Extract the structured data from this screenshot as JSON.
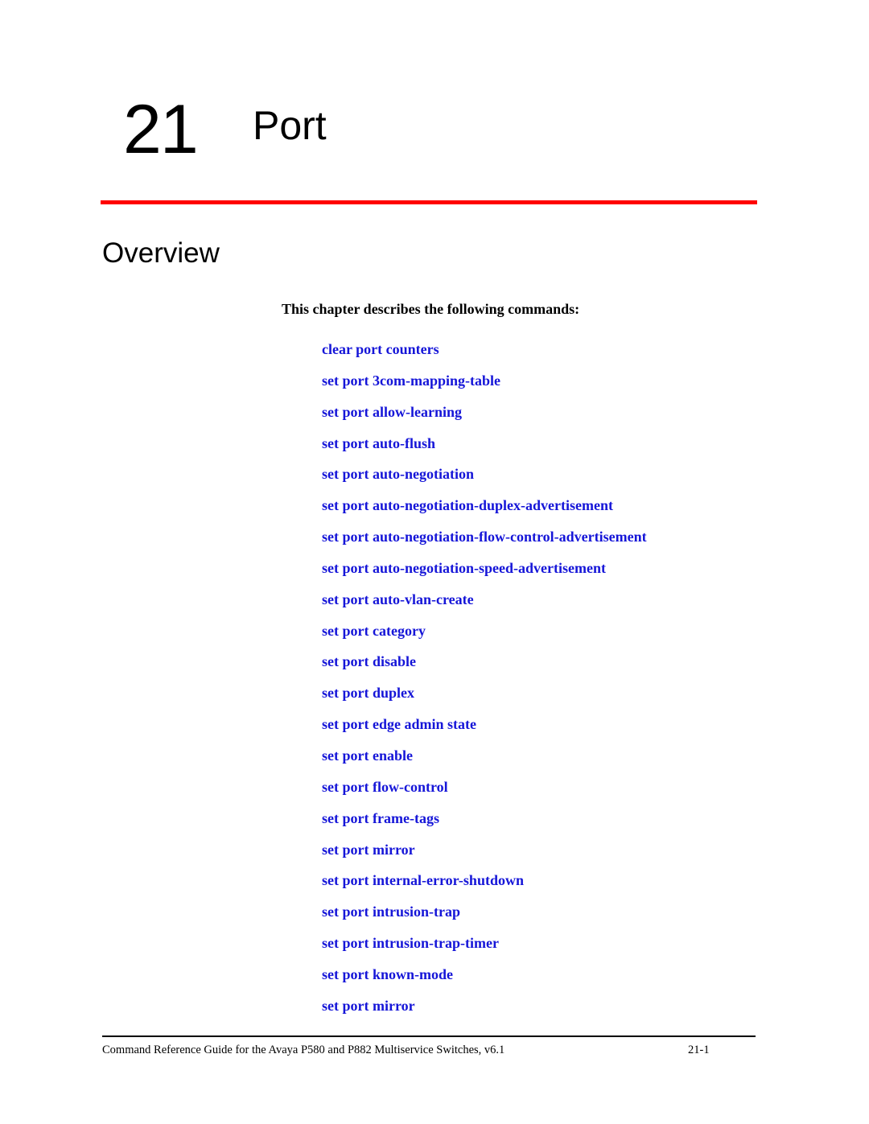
{
  "chapter": {
    "number": "21",
    "title": "Port"
  },
  "section": {
    "title": "Overview",
    "intro": "This chapter describes the following commands:"
  },
  "commands": [
    "clear port counters",
    "set port 3com-mapping-table",
    "set port allow-learning",
    "set port auto-flush",
    "set port auto-negotiation",
    "set port auto-negotiation-duplex-advertisement",
    "set port auto-negotiation-flow-control-advertisement",
    "set port auto-negotiation-speed-advertisement",
    "set port auto-vlan-create",
    "set port category",
    "set port disable",
    "set port duplex",
    "set port edge admin state",
    "set port enable",
    "set port flow-control",
    "set port frame-tags",
    "set port mirror",
    "set port internal-error-shutdown",
    "set port intrusion-trap",
    "set port intrusion-trap-timer",
    "set port known-mode",
    "set port mirror"
  ],
  "footer": {
    "text": "Command Reference Guide for the Avaya P580 and P882 Multiservice Switches, v6.1",
    "page": "21-1"
  },
  "colors": {
    "rule": "#ff0000",
    "link": "#1515d8"
  }
}
